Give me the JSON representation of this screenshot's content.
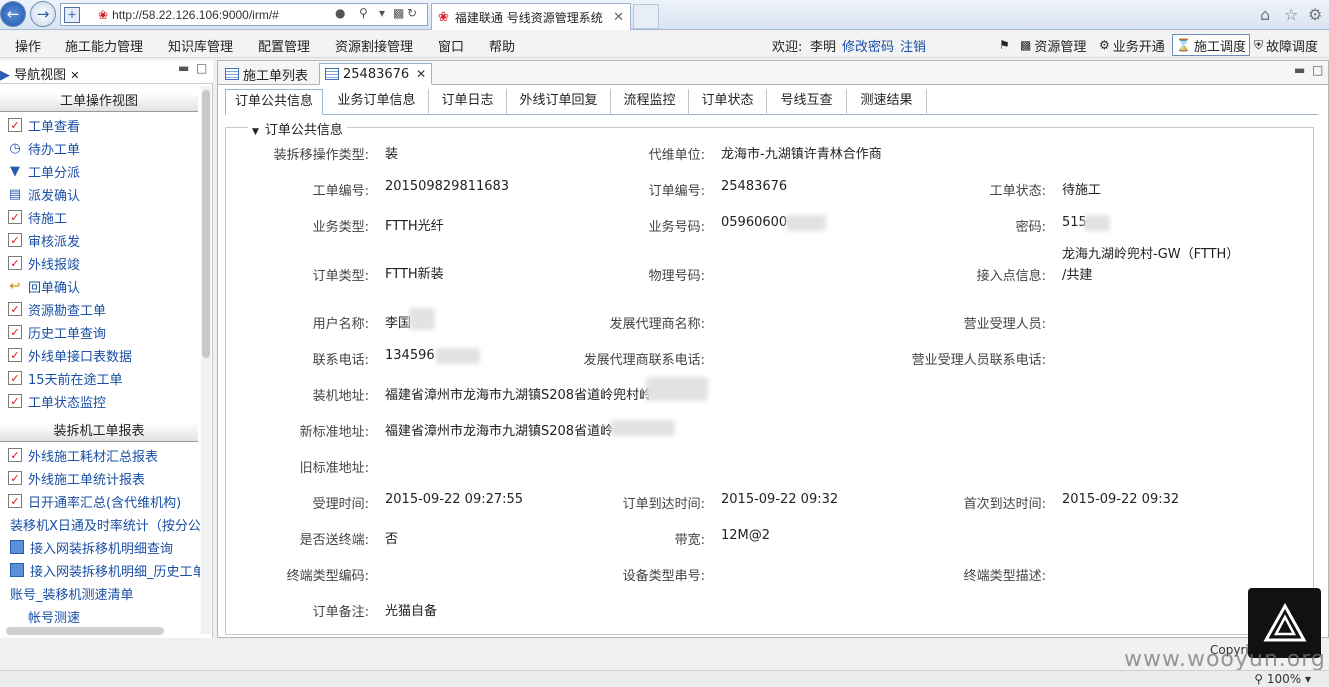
{
  "browser": {
    "url": "http://58.22.126.106:9000/irm/#",
    "tab_title": "福建联通 号线资源管理系统"
  },
  "menubar": {
    "items": [
      "操作",
      "施工能力管理",
      "知识库管理",
      "配置管理",
      "资源割接管理",
      "窗口",
      "帮助"
    ],
    "welcome_label": "欢迎:",
    "user": "李明",
    "change_password": "修改密码",
    "logout": "注销",
    "quick_links": [
      "资源管理",
      "业务开通",
      "施工调度",
      "故障调度"
    ]
  },
  "nav": {
    "title": "导航视图",
    "section1_title": "工单操作视图",
    "section1_items": [
      "工单查看",
      "待办工单",
      "工单分派",
      "派发确认",
      "待施工",
      "审核派发",
      "外线报竣",
      "回单确认",
      "资源勘查工单",
      "历史工单查询",
      "外线单接口表数据",
      "15天前在途工单",
      "工单状态监控"
    ],
    "section2_title": "装拆机工单报表",
    "section2_items": [
      "外线施工耗材汇总报表",
      "外线施工单统计报表",
      "日开通率汇总(含代维机构)",
      "装移机X日通及时率统计（按分公",
      "接入网装拆移机明细查询",
      "接入网装拆移机明细_历史工单",
      "账号_装移机测速清单",
      "帐号测速"
    ]
  },
  "editor": {
    "tabs": [
      "施工单列表",
      "25483676"
    ],
    "subtabs": [
      "订单公共信息",
      "业务订单信息",
      "订单日志",
      "外线订单回复",
      "流程监控",
      "订单状态",
      "号线互查",
      "测速结果"
    ],
    "group_title": "订单公共信息"
  },
  "fields": {
    "op_type_label": "装拆移操作类型:",
    "op_type": "装",
    "agent_unit_label": "代维单位:",
    "agent_unit": "龙海市-九湖镇许青林合作商",
    "wo_no_label": "工单编号:",
    "wo_no": "201509829811683",
    "order_no_label": "订单编号:",
    "order_no": "25483676",
    "wo_status_label": "工单状态:",
    "wo_status": "待施工",
    "biz_type_label": "业务类型:",
    "biz_type": "FTTH光纤",
    "biz_no_label": "业务号码:",
    "biz_no": "05960600",
    "password_label": "密码:",
    "password": "515",
    "order_type_label": "订单类型:",
    "order_type": "FTTH新装",
    "phys_no_label": "物理号码:",
    "access_point_label": "接入点信息:",
    "access_point_line1": "龙海九湖岭兜村-GW（FTTH）",
    "access_point_line2": "/共建",
    "user_name_label": "用户名称:",
    "user_name": "李国",
    "dev_agent_label": "发展代理商名称:",
    "biz_staff_label": "营业受理人员:",
    "contact_phone_label": "联系电话:",
    "contact_phone": "134596",
    "dev_agent_phone_label": "发展代理商联系电话:",
    "biz_staff_phone_label": "营业受理人员联系电话:",
    "install_addr_label": "装机地址:",
    "install_addr": "福建省漳州市龙海市九湖镇S208省道岭兜村岭",
    "new_addr_label": "新标准地址:",
    "new_addr": "福建省漳州市龙海市九湖镇S208省道岭",
    "old_addr_label": "旧标准地址:",
    "accept_time_label": "受理时间:",
    "accept_time": "2015-09-22 09:27:55",
    "order_arrive_label": "订单到达时间:",
    "order_arrive": "2015-09-22 09:32",
    "first_arrive_label": "首次到达时间:",
    "first_arrive": "2015-09-22 09:32",
    "terminal_sent_label": "是否送终端:",
    "terminal_sent": "否",
    "bandwidth_label": "带宽:",
    "bandwidth": "12M@2",
    "terminal_type_code_label": "终端类型编码:",
    "device_serial_label": "设备类型串号:",
    "terminal_type_desc_label": "终端类型描述:",
    "remark_label": "订单备注:",
    "remark": "光猫自备"
  },
  "footer": {
    "copyright": "Copyri",
    "watermark": "www.wooyun.org",
    "zoom": "100%"
  }
}
